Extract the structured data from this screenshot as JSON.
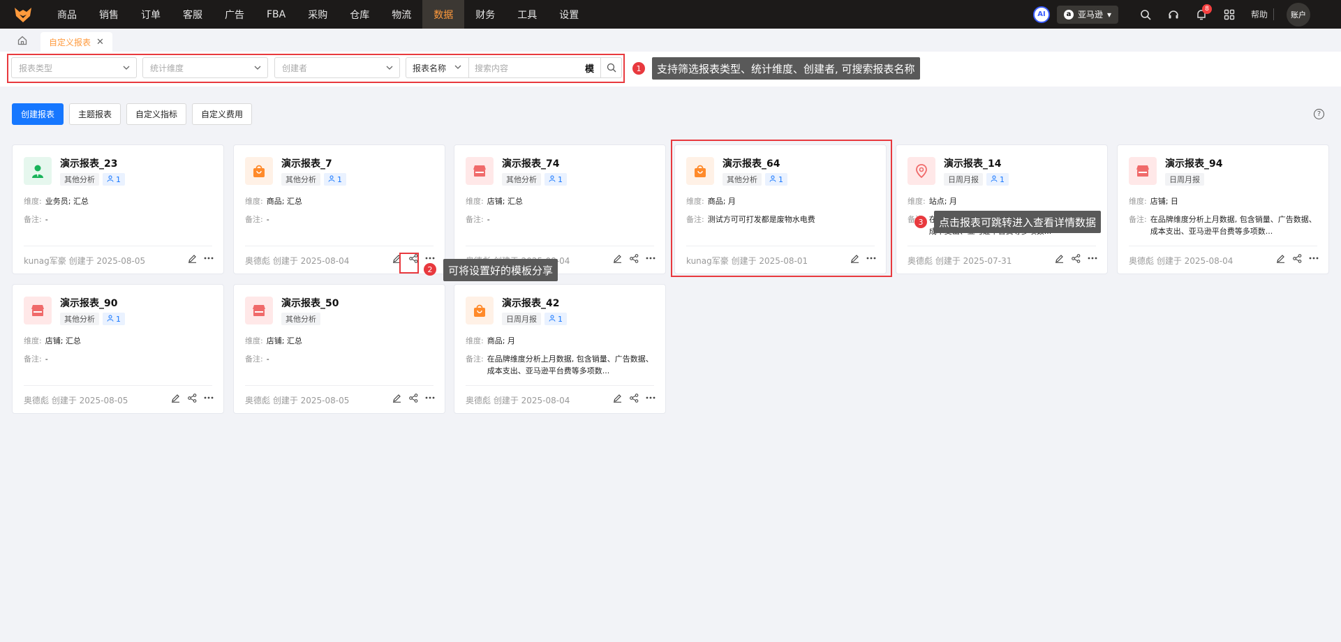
{
  "nav": {
    "items": [
      "商品",
      "销售",
      "订单",
      "客服",
      "广告",
      "FBA",
      "采购",
      "仓库",
      "物流",
      "数据",
      "财务",
      "工具",
      "设置"
    ],
    "active_index": 9,
    "ai_label": "AI",
    "platform": "亚马逊",
    "platform_logo": "a",
    "notification_count": "8",
    "help": "帮助",
    "account": "账户"
  },
  "tabs": {
    "active_label": "自定义报表"
  },
  "filters": {
    "report_type_placeholder": "报表类型",
    "dimension_placeholder": "统计维度",
    "creator_placeholder": "创建者",
    "search_field": "报表名称",
    "search_placeholder": "搜索内容",
    "search_mode": "模"
  },
  "actions": {
    "create": "创建报表",
    "theme": "主题报表",
    "custom_metric": "自定义指标",
    "custom_cost": "自定义费用",
    "help": "?"
  },
  "labels": {
    "dimension": "维度:",
    "remark": "备注:"
  },
  "cards": [
    {
      "title": "演示报表_23",
      "category": "其他分析",
      "share_count": "1",
      "dimension": "业务员; 汇总",
      "remark": "-",
      "footer": "kunag军豪 创建于 2025-08-05",
      "icon": "person-icon",
      "share": false
    },
    {
      "title": "演示报表_7",
      "category": "其他分析",
      "share_count": "1",
      "dimension": "商品; 汇总",
      "remark": "-",
      "footer": "奥德彪 创建于 2025-08-04",
      "icon": "bag-icon",
      "share": true
    },
    {
      "title": "演示报表_74",
      "category": "其他分析",
      "share_count": "1",
      "dimension": "店铺; 汇总",
      "remark": "-",
      "footer": "奥德彪 创建于 2025-08-04",
      "icon": "store-icon",
      "share": true
    },
    {
      "title": "演示报表_64",
      "category": "其他分析",
      "share_count": "1",
      "dimension": "商品; 月",
      "remark": "测试方可可打发都是废物水电费",
      "footer": "kunag军豪 创建于 2025-08-01",
      "icon": "bag-icon",
      "share": false
    },
    {
      "title": "演示报表_14",
      "category": "日周月报",
      "share_count": "1",
      "dimension": "站点; 月",
      "remark": "在品牌维度分析上月数据, 包含销量、广告数据、成本支出、亚马逊平台费等多项数...",
      "footer": "奥德彪 创建于 2025-07-31",
      "icon": "location-icon",
      "share": true
    },
    {
      "title": "演示报表_94",
      "category": "日周月报",
      "share_count": "",
      "dimension": "店铺; 日",
      "remark": "在品牌维度分析上月数据, 包含销量、广告数据、成本支出、亚马逊平台费等多项数...",
      "footer": "奥德彪 创建于 2025-08-04",
      "icon": "store-icon",
      "share": true
    },
    {
      "title": "演示报表_90",
      "category": "其他分析",
      "share_count": "1",
      "dimension": "店铺; 汇总",
      "remark": "-",
      "footer": "奥德彪 创建于 2025-08-05",
      "icon": "store-icon",
      "share": true
    },
    {
      "title": "演示报表_50",
      "category": "其他分析",
      "share_count": "",
      "dimension": "店铺; 汇总",
      "remark": "-",
      "footer": "奥德彪 创建于 2025-08-05",
      "icon": "store-icon",
      "share": true
    },
    {
      "title": "演示报表_42",
      "category": "日周月报",
      "share_count": "1",
      "dimension": "商品; 月",
      "remark": "在品牌维度分析上月数据, 包含销量、广告数据、成本支出、亚马逊平台费等多项数...",
      "footer": "奥德彪 创建于 2025-08-04",
      "icon": "bag-icon",
      "share": true
    }
  ],
  "callouts": [
    {
      "number": "1",
      "text": "支持筛选报表类型、统计维度、创建者, 可搜索报表名称"
    },
    {
      "number": "2",
      "text": "可将设置好的模板分享"
    },
    {
      "number": "3",
      "text": "点击报表可跳转进入查看详情数据"
    }
  ],
  "colors": {
    "accent": "#ff9a3c",
    "primary": "#1677ff",
    "highlight": "#e8393e",
    "nav_bg": "#1c1a19",
    "icon_green_bg": "#e6f7ee",
    "icon_green": "#19b35a",
    "icon_orange_bg": "#fff1e6",
    "icon_orange": "#ff8a2a",
    "icon_red_bg": "#ffe8e8",
    "icon_red": "#f06a6a"
  }
}
